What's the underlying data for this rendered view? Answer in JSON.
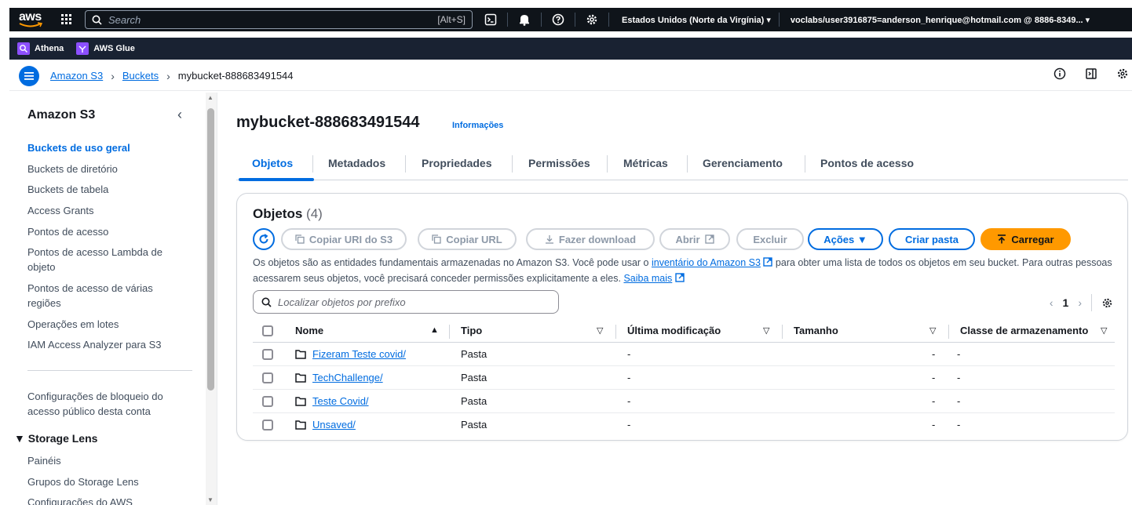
{
  "topnav": {
    "logo_text": "aws",
    "search_placeholder": "Search",
    "search_shortcut": "[Alt+S]",
    "region": "Estados Unidos (Norte da Virgínia) ▾",
    "account": "voclabs/user3916875=anderson_henrique@hotmail.com @ 8886-8349... ▾"
  },
  "favorites": [
    {
      "label": "Athena"
    },
    {
      "label": "AWS Glue"
    }
  ],
  "breadcrumb": {
    "items": [
      "Amazon S3",
      "Buckets"
    ],
    "current": "mybucket-888683491544"
  },
  "sidenav": {
    "title": "Amazon S3",
    "items": [
      "Buckets de uso geral",
      "Buckets de diretório",
      "Buckets de tabela",
      "Access Grants",
      "Pontos de acesso",
      "Pontos de acesso Lambda de objeto",
      "Pontos de acesso de várias regiões",
      "Operações em lotes",
      "IAM Access Analyzer para S3"
    ],
    "block_public": "Configurações de bloqueio do acesso público desta conta",
    "storage_lens": {
      "title": "▼ Storage Lens",
      "items": [
        "Painéis",
        "Grupos do Storage Lens",
        "Configurações do AWS"
      ]
    }
  },
  "main": {
    "bucket_name": "mybucket-888683491544",
    "info": "Informações",
    "tabs": [
      "Objetos",
      "Metadados",
      "Propriedades",
      "Permissões",
      "Métricas",
      "Gerenciamento",
      "Pontos de acesso"
    ],
    "panel": {
      "title": "Objetos",
      "count": "(4)",
      "buttons": {
        "copy_uri": "Copiar URI do S3",
        "copy_url": "Copiar URL",
        "download": "Fazer download",
        "open": "Abrir",
        "delete": "Excluir",
        "actions": "Ações ▼",
        "create_folder": "Criar pasta",
        "upload": "Carregar"
      },
      "desc_part1": "Os objetos são as entidades fundamentais armazenadas no Amazon S3. Você pode usar o ",
      "desc_link1": "inventário do Amazon S3",
      "desc_part2": " para obter uma lista de todos os objetos em seu bucket. Para outras pessoas acessarem seus objetos, você precisará conceder permissões explicitamente a eles. ",
      "desc_link2": "Saiba mais",
      "filter_placeholder": "Localizar objetos por prefixo",
      "page": "1",
      "columns": [
        "Nome",
        "Tipo",
        "Última modificação",
        "Tamanho",
        "Classe de armazenamento"
      ],
      "rows": [
        {
          "name": "Fizeram Teste covid/",
          "type": "Pasta",
          "modified": "-",
          "size": "-",
          "class": "-"
        },
        {
          "name": "TechChallenge/",
          "type": "Pasta",
          "modified": "-",
          "size": "-",
          "class": "-"
        },
        {
          "name": "Teste Covid/",
          "type": "Pasta",
          "modified": "-",
          "size": "-",
          "class": "-"
        },
        {
          "name": "Unsaved/",
          "type": "Pasta",
          "modified": "-",
          "size": "-",
          "class": "-"
        }
      ]
    }
  }
}
